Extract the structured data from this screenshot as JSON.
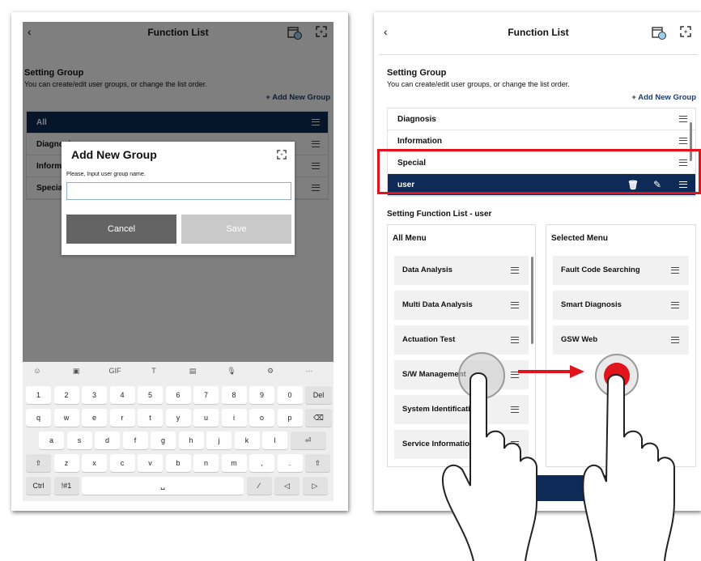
{
  "app": {
    "title": "Function List",
    "back_icon": "chevron-left-icon",
    "calendar_icon": "calendar-icon",
    "fullscreen_icon": "fullscreen-icon"
  },
  "setting_group": {
    "title": "Setting Group",
    "description": "You can create/edit user groups, or change the list order.",
    "add_new_group": "+ Add New Group"
  },
  "left_groups": [
    {
      "label": "All",
      "active": true
    },
    {
      "label": "Diagnosis",
      "active": false
    },
    {
      "label": "Information",
      "active": false
    },
    {
      "label": "Special",
      "active": false
    }
  ],
  "right_groups": [
    {
      "label": "Diagnosis",
      "active": false
    },
    {
      "label": "Information",
      "active": false
    },
    {
      "label": "Special",
      "active": false
    },
    {
      "label": "user",
      "active": true
    }
  ],
  "dialog": {
    "title": "Add New Group",
    "input_label": "Please, Input user group name.",
    "input_value": "",
    "cancel": "Cancel",
    "save": "Save"
  },
  "keyboard": {
    "tools": [
      "☺",
      "▣",
      "GIF",
      "T",
      "▤",
      "🎙",
      "⚙",
      "···"
    ],
    "row1": [
      "1",
      "2",
      "3",
      "4",
      "5",
      "6",
      "7",
      "8",
      "9",
      "0",
      "Del"
    ],
    "row2": [
      "q",
      "w",
      "e",
      "r",
      "t",
      "y",
      "u",
      "i",
      "o",
      "p",
      "⌫"
    ],
    "row3": [
      "a",
      "s",
      "d",
      "f",
      "g",
      "h",
      "j",
      "k",
      "l",
      "⏎"
    ],
    "row4": [
      "⇧",
      "z",
      "x",
      "c",
      "v",
      "b",
      "n",
      "m",
      ",",
      ".",
      "⇧"
    ],
    "row5": [
      "Ctrl",
      "!#1",
      "␣",
      "⁄",
      "◁",
      "▷"
    ]
  },
  "function_list": {
    "title": "Setting Function List - user",
    "all_menu_title": "All Menu",
    "selected_menu_title": "Selected Menu",
    "all_menu": [
      "Data Analysis",
      "Multi Data Analysis",
      "Actuation Test",
      "S/W Management",
      "System Identification",
      "Service Information"
    ],
    "selected_menu": [
      "Fault Code Searching",
      "Smart Diagnosis",
      "GSW Web"
    ]
  },
  "colors": {
    "accent_navy": "#0e2b57",
    "highlight_red": "#e1141c",
    "touch_red": "#e1141c"
  }
}
